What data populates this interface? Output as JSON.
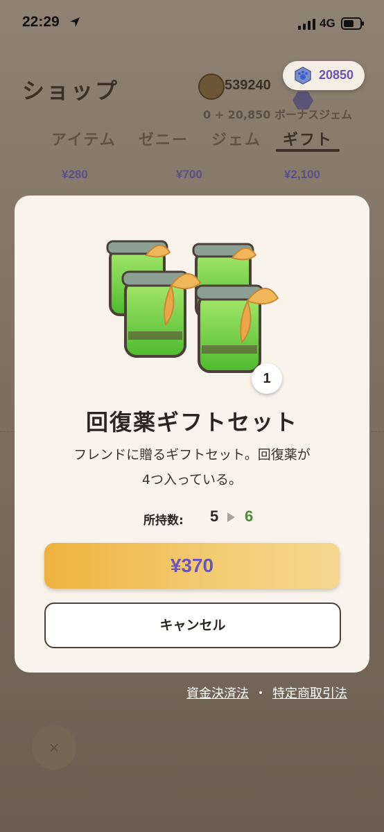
{
  "status_bar": {
    "time": "22:29",
    "network": "4G"
  },
  "shop": {
    "title": "ショップ",
    "zeny": "539240",
    "gems": "20850",
    "bonus_text": "0 + 20,850 ボーナスジェム",
    "tabs": [
      {
        "label": "アイテム",
        "active": false
      },
      {
        "label": "ゼニー",
        "active": false
      },
      {
        "label": "ジェム",
        "active": false
      },
      {
        "label": "ギフト",
        "active": true
      }
    ],
    "prices": [
      "¥280",
      "¥700",
      "¥2,100"
    ]
  },
  "modal": {
    "quantity_badge": "1",
    "title": "回復薬ギフトセット",
    "description_line1": "フレンドに贈るギフトセット。回復薬が",
    "description_line2": "4つ入っている。",
    "owned_label": "所持数:",
    "owned_from": "5",
    "owned_to": "6",
    "buy_label": "¥370",
    "cancel_label": "キャンセル"
  },
  "footer": {
    "link1": "資金決済法",
    "separator": "・",
    "link2": "特定商取引法",
    "close_label": "×"
  },
  "colors": {
    "accent_purple": "#6b55b7",
    "buy_gold": "#eeb240",
    "owned_green": "#4e8a3c",
    "modal_bg": "#f8f3eb"
  }
}
